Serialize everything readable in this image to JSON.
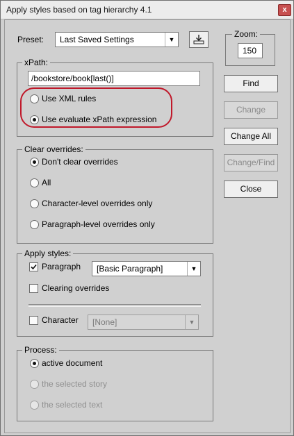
{
  "window": {
    "title": "Apply styles based on tag hierarchy 4.1",
    "close_label": "x"
  },
  "preset": {
    "label": "Preset:",
    "value": "Last Saved Settings"
  },
  "zoom": {
    "label": "Zoom:",
    "value": "150"
  },
  "xpath": {
    "title": "xPath:",
    "expression": "/bookstore/book[last()]",
    "options": [
      {
        "label": "Use XML rules",
        "selected": false
      },
      {
        "label": "Use evaluate xPath expression",
        "selected": true
      }
    ]
  },
  "clear_overrides": {
    "title": "Clear overrides:",
    "options": [
      {
        "label": "Don't clear overrides",
        "selected": true
      },
      {
        "label": "All",
        "selected": false
      },
      {
        "label": "Character-level overrides only",
        "selected": false
      },
      {
        "label": "Paragraph-level overrides only",
        "selected": false
      }
    ]
  },
  "apply_styles": {
    "title": "Apply styles:",
    "paragraph_label": "Paragraph",
    "paragraph_checked": true,
    "paragraph_style": "[Basic Paragraph]",
    "clearing_label": "Clearing overrides",
    "clearing_checked": false,
    "character_label": "Character",
    "character_checked": false,
    "character_style": "[None]"
  },
  "process": {
    "title": "Process:",
    "options": [
      {
        "label": "active document",
        "selected": true,
        "enabled": true
      },
      {
        "label": "the selected story",
        "selected": false,
        "enabled": false
      },
      {
        "label": "the selected text",
        "selected": false,
        "enabled": false
      }
    ]
  },
  "buttons": {
    "find": "Find",
    "change": "Change",
    "change_all": "Change All",
    "change_find": "Change/Find",
    "close": "Close"
  },
  "colors": {
    "annotation_ellipse": "#c0182a"
  }
}
